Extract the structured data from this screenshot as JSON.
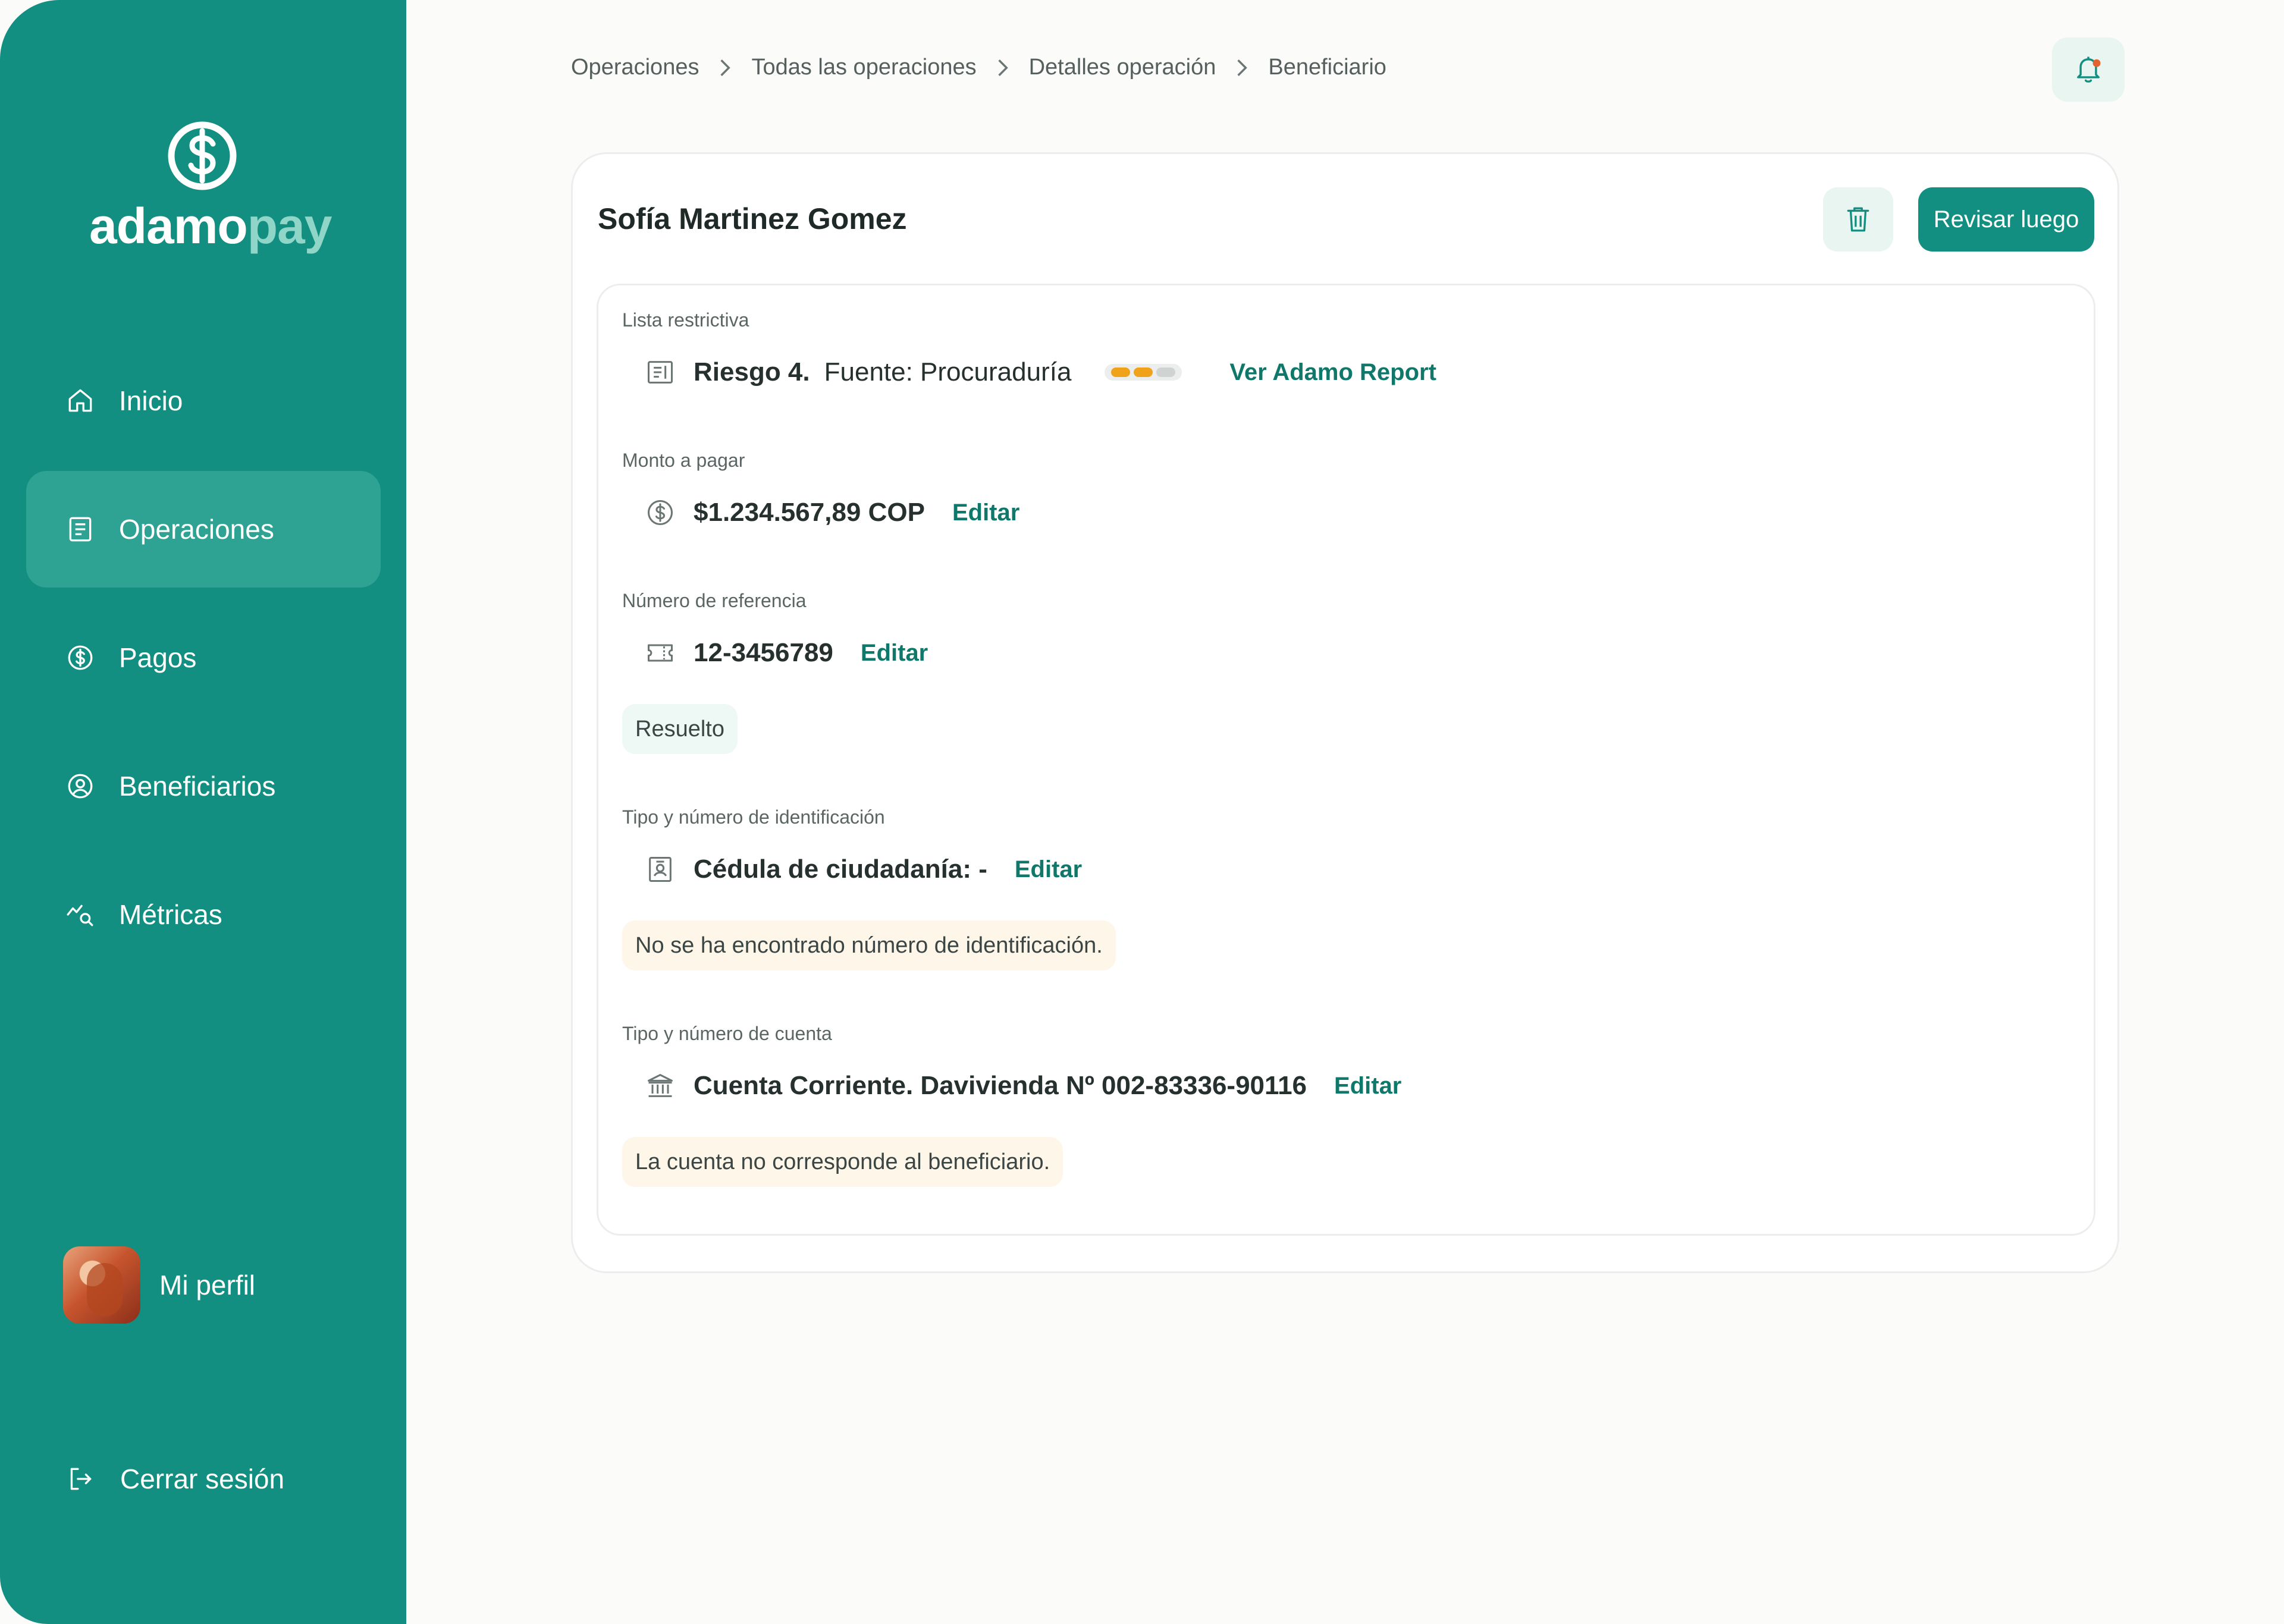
{
  "brand": {
    "name_part1": "adamo",
    "name_part2": "pay",
    "logo_icon": "dollar-circle-icon",
    "primary_color": "#128f80",
    "secondary_color": "#8fd6c9"
  },
  "sidebar": {
    "items": [
      {
        "label": "Inicio",
        "icon": "home-icon",
        "active": false
      },
      {
        "label": "Operaciones",
        "icon": "document-list-icon",
        "active": true
      },
      {
        "label": "Pagos",
        "icon": "dollar-circle-icon",
        "active": false
      },
      {
        "label": "Beneficiarios",
        "icon": "user-circle-icon",
        "active": false
      },
      {
        "label": "Métricas",
        "icon": "chart-search-icon",
        "active": false
      }
    ],
    "profile_label": "Mi perfil",
    "logout_label": "Cerrar sesión"
  },
  "header": {
    "breadcrumb": [
      "Operaciones",
      "Todas las operaciones",
      "Detalles operación",
      "Beneficiario"
    ],
    "notification_icon": "bell-icon",
    "notification_dot_color": "#e2632f"
  },
  "card": {
    "title": "Sofía Martinez Gomez",
    "delete_icon": "trash-icon",
    "review_button": "Revisar luego",
    "sections": {
      "restrictive": {
        "label": "Lista restrictiva",
        "risk": "Riesgo 4.",
        "source": "Fuente: Procuraduría",
        "risk_level": 2,
        "risk_max": 3,
        "risk_color": "#f0a21b",
        "link": "Ver Adamo Report"
      },
      "amount": {
        "label": "Monto a pagar",
        "value": "$1.234.567,89 COP",
        "edit": "Editar"
      },
      "reference": {
        "label": "Número de referencia",
        "value": "12-3456789",
        "edit": "Editar",
        "status": "Resuelto"
      },
      "identification": {
        "label": "Tipo y número de identificación",
        "value": "Cédula de ciudadanía: -",
        "edit": "Editar",
        "warning": "No se ha encontrado número de identificación."
      },
      "account": {
        "label": "Tipo y número de cuenta",
        "value": "Cuenta Corriente. Davivienda Nº 002-83336-90116",
        "edit": "Editar",
        "warning": "La cuenta no corresponde al beneficiario."
      }
    }
  }
}
